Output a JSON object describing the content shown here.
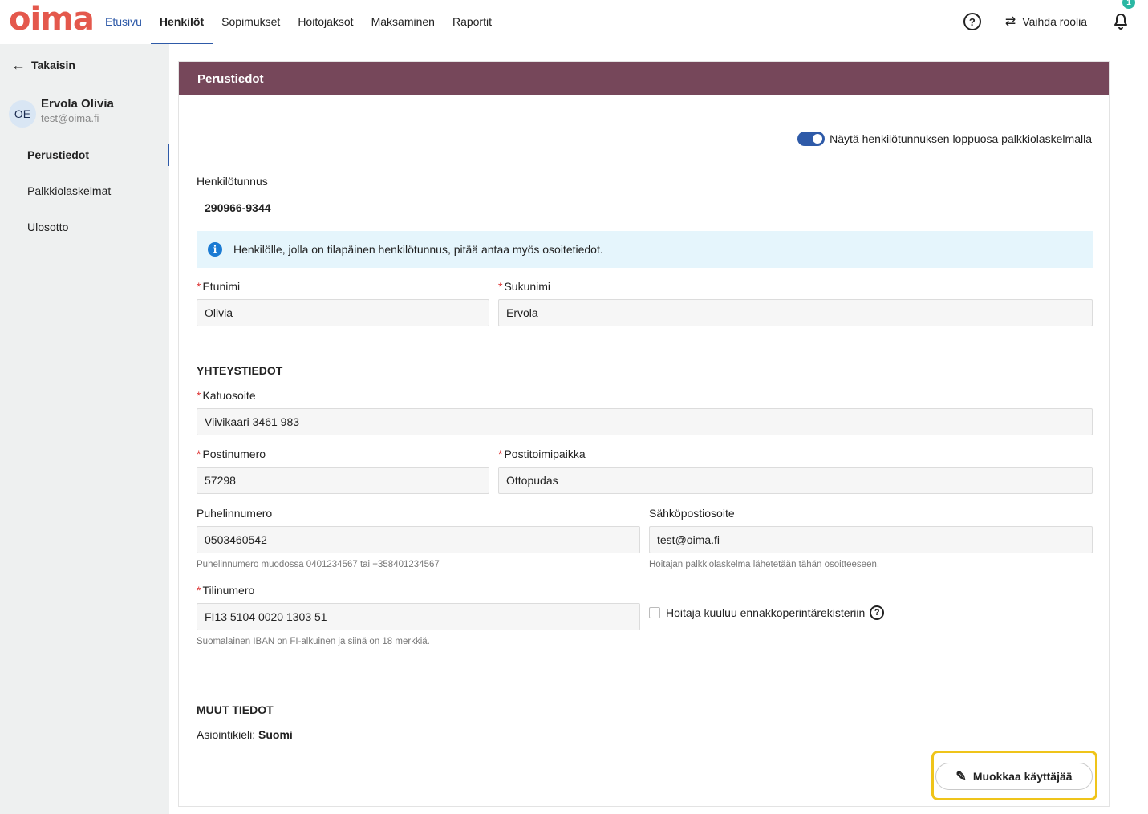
{
  "app": {
    "logo": "oima"
  },
  "nav": {
    "items": [
      "Etusivu",
      "Henkilöt",
      "Sopimukset",
      "Hoitojaksot",
      "Maksaminen",
      "Raportit"
    ],
    "active": "Henkilöt"
  },
  "top_right": {
    "help": "?",
    "switch_role_label": "Vaihda roolia",
    "notification_count": "1"
  },
  "sidebar": {
    "back_label": "Takaisin",
    "user": {
      "initials": "OE",
      "name": "Ervola Olivia",
      "email": "test@oima.fi"
    },
    "items": [
      "Perustiedot",
      "Palkkiolaskelmat",
      "Ulosotto"
    ],
    "active": "Perustiedot"
  },
  "card": {
    "title": "Perustiedot",
    "toggle_label": "Näytä henkilötunnuksen loppuosa palkkiolaskelmalla",
    "toggle_on": true,
    "ssn_label": "Henkilötunnus",
    "ssn_value": "290966-9344",
    "info_text": "Henkilölle, jolla on tilapäinen henkilötunnus, pitää antaa myös osoitetiedot.",
    "first_name": {
      "label": "Etunimi",
      "value": "Olivia"
    },
    "last_name": {
      "label": "Sukunimi",
      "value": "Ervola"
    },
    "contact_title": "YHTEYSTIEDOT",
    "street": {
      "label": "Katuosoite",
      "value": "Viivikaari 3461 983"
    },
    "postal_code": {
      "label": "Postinumero",
      "value": "57298"
    },
    "city": {
      "label": "Postitoimipaikka",
      "value": "Ottopudas"
    },
    "phone": {
      "label": "Puhelinnumero",
      "value": "0503460542",
      "hint": "Puhelinnumero muodossa 0401234567 tai +358401234567"
    },
    "email": {
      "label": "Sähköpostiosoite",
      "value": "test@oima.fi",
      "hint": "Hoitajan palkkiolaskelma lähetetään tähän osoitteeseen."
    },
    "iban": {
      "label": "Tilinumero",
      "value": "FI13 5104 0020 1303 51",
      "hint": "Suomalainen IBAN on FI-alkuinen ja siinä on 18 merkkiä."
    },
    "prepayment_checkbox": {
      "label": "Hoitaja kuuluu ennakkoperintärekisteriin",
      "checked": false
    },
    "other_title": "MUUT TIEDOT",
    "language_label": "Asiointikieli:",
    "language_value": "Suomi",
    "edit_button": "Muokkaa käyttäjää"
  },
  "colors": {
    "brand": "#e4584c",
    "header": "#76475a",
    "accent": "#2e5aa8",
    "info_bg": "#e5f5fc",
    "highlight": "#efc41a"
  }
}
